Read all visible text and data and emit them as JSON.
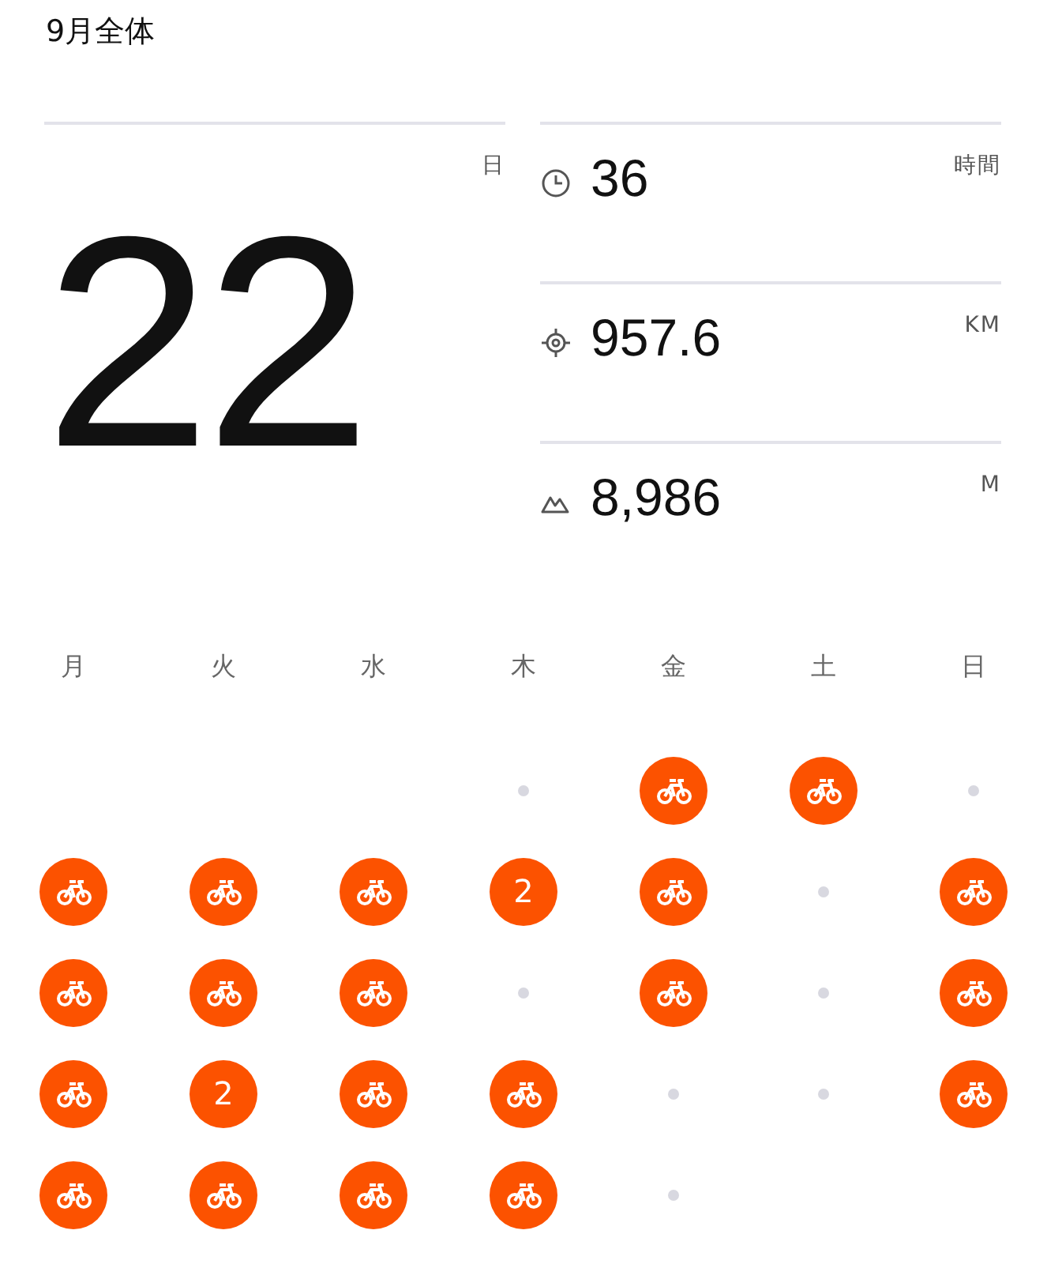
{
  "title": "9月全体",
  "days": {
    "unit": "日",
    "value": "22"
  },
  "stats": [
    {
      "kind": "time",
      "value": "36",
      "unit": "時間"
    },
    {
      "kind": "distance",
      "value": "957.6",
      "unit": "KM"
    },
    {
      "kind": "elevation",
      "value": "8,986",
      "unit": "M"
    }
  ],
  "weekdays": [
    "月",
    "火",
    "水",
    "木",
    "金",
    "土",
    "日"
  ],
  "calendar": [
    [
      {
        "kind": "blank"
      },
      {
        "kind": "blank"
      },
      {
        "kind": "blank"
      },
      {
        "kind": "none"
      },
      {
        "kind": "ride"
      },
      {
        "kind": "ride"
      },
      {
        "kind": "none"
      }
    ],
    [
      {
        "kind": "ride"
      },
      {
        "kind": "ride"
      },
      {
        "kind": "ride"
      },
      {
        "kind": "count",
        "text": "2"
      },
      {
        "kind": "ride"
      },
      {
        "kind": "none"
      },
      {
        "kind": "ride"
      }
    ],
    [
      {
        "kind": "ride"
      },
      {
        "kind": "ride"
      },
      {
        "kind": "ride"
      },
      {
        "kind": "none"
      },
      {
        "kind": "ride"
      },
      {
        "kind": "none"
      },
      {
        "kind": "ride"
      }
    ],
    [
      {
        "kind": "ride"
      },
      {
        "kind": "count",
        "text": "2"
      },
      {
        "kind": "ride"
      },
      {
        "kind": "ride"
      },
      {
        "kind": "none"
      },
      {
        "kind": "none"
      },
      {
        "kind": "ride"
      }
    ],
    [
      {
        "kind": "ride"
      },
      {
        "kind": "ride"
      },
      {
        "kind": "ride"
      },
      {
        "kind": "ride"
      },
      {
        "kind": "none"
      },
      {
        "kind": "blank"
      },
      {
        "kind": "blank"
      }
    ]
  ]
}
